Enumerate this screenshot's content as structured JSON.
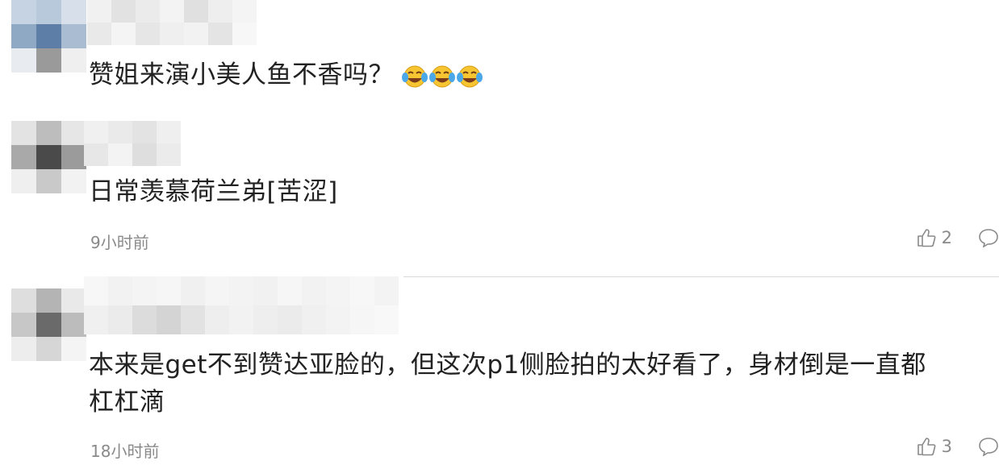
{
  "comments": [
    {
      "text": "赞姐来演小美人鱼不香吗？",
      "emojis": [
        "laugh-cry-emoji",
        "laugh-cry-emoji",
        "laugh-cry-emoji"
      ]
    },
    {
      "text": "日常羡慕荷兰弟[苦涩]",
      "time": "9小时前",
      "likes": "2"
    },
    {
      "text_line1": "本来是get不到赞达亚脸的，但这次p1侧脸拍的太好看了，身材倒是一直都",
      "text_line2": "杠杠滴",
      "time": "18小时前",
      "likes": "3"
    }
  ],
  "icons": {
    "like": "thumbs-up-icon",
    "reply": "speech-bubble-icon",
    "emoji": "laugh-cry-emoji"
  },
  "colors": {
    "text": "#222222",
    "meta": "#8a8a8a",
    "divider": "#d9d9d9"
  }
}
